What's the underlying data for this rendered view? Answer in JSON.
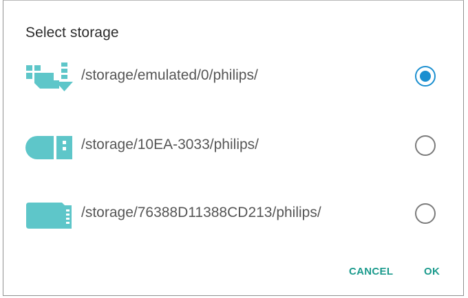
{
  "dialog": {
    "title": "Select storage",
    "options": [
      {
        "path": "/storage/emulated/0/philips/",
        "icon": "internal-storage-icon",
        "selected": true
      },
      {
        "path": "/storage/10EA-3033/philips/",
        "icon": "usb-drive-icon",
        "selected": false
      },
      {
        "path": "/storage/76388D11388CD213/philips/",
        "icon": "sd-card-icon",
        "selected": false
      }
    ],
    "buttons": {
      "cancel": "CANCEL",
      "ok": "OK"
    }
  },
  "colors": {
    "icon": "#5ec6c9",
    "radio_selected": "#1a8fd0",
    "button_text": "#1a9a8c"
  }
}
